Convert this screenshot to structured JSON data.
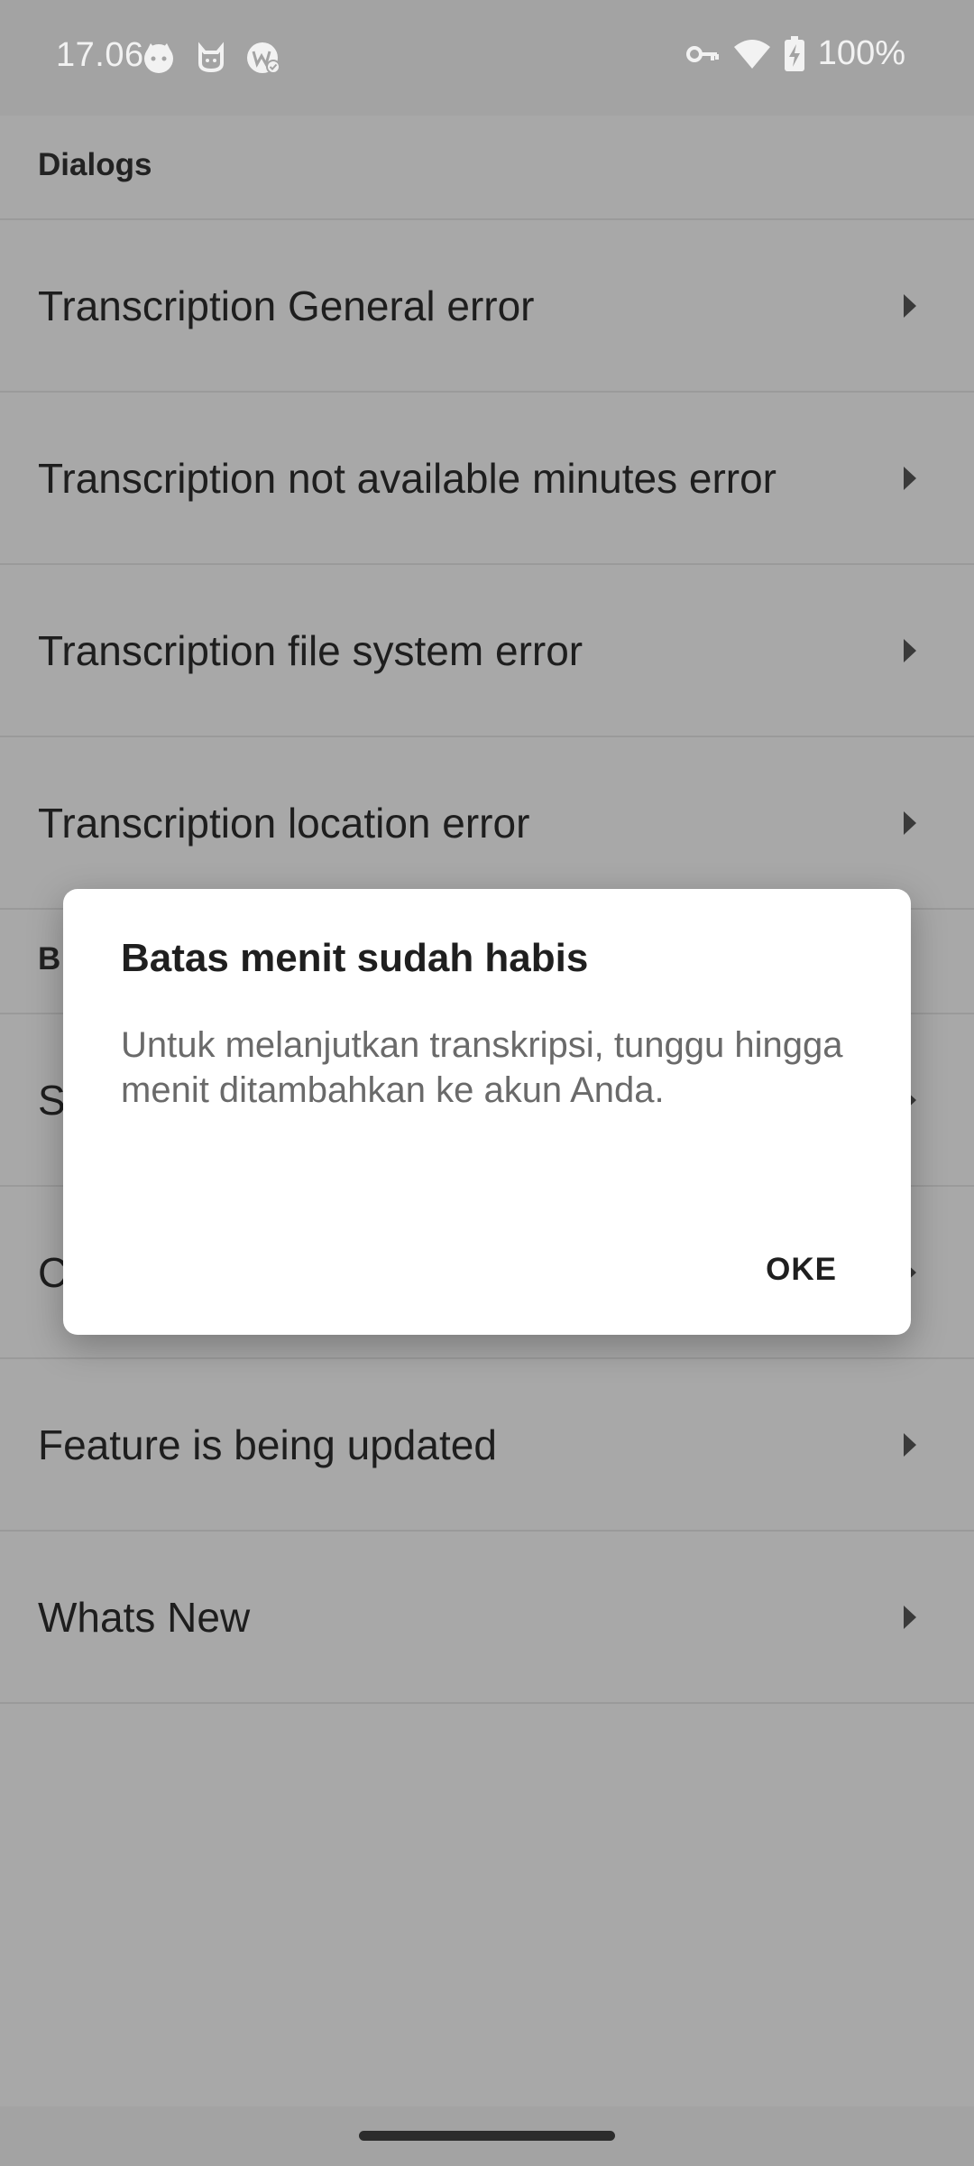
{
  "status_bar": {
    "time": "17.06",
    "battery_percent": "100%",
    "left_icons": [
      "cat-face-icon",
      "cat-outline-icon",
      "w-badge-icon"
    ],
    "right_icons": [
      "vpn-key-icon",
      "wifi-icon",
      "battery-charging-icon"
    ]
  },
  "sections": [
    {
      "header": "Dialogs",
      "items": [
        {
          "label": "Transcription General error"
        },
        {
          "label": "Transcription not available minutes error"
        },
        {
          "label": "Transcription file system error"
        },
        {
          "label": "Transcription location error"
        }
      ]
    },
    {
      "header": "B",
      "items": [
        {
          "label": "S"
        },
        {
          "label": "C"
        },
        {
          "label": "Feature is being updated"
        },
        {
          "label": "Whats New"
        }
      ]
    }
  ],
  "dialog": {
    "title": "Batas menit sudah habis",
    "message": "Untuk melanjutkan transkripsi, tunggu hingga menit ditambahkan ke akun Anda.",
    "ok_label": "OKE"
  },
  "colors": {
    "scrim_background": "#a8a8a8",
    "dialog_background": "#ffffff",
    "title_text": "#1f1f1f",
    "message_text": "#6a6a6a"
  }
}
